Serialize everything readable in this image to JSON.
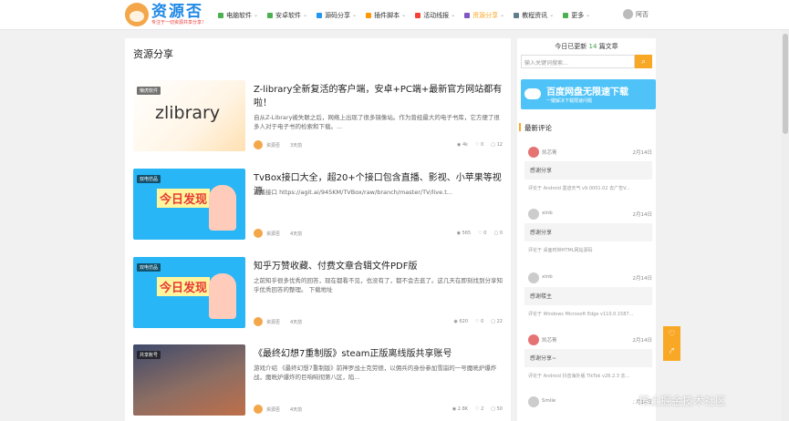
{
  "header": {
    "logo_text": "资源否",
    "logo_sub": "专注于一切资源共享分享！",
    "nav": [
      {
        "label": "电脑软件",
        "color": "#4caf50"
      },
      {
        "label": "安卓软件",
        "color": "#4caf50"
      },
      {
        "label": "源码分享",
        "color": "#2196f3"
      },
      {
        "label": "插件脚本",
        "color": "#ff9800"
      },
      {
        "label": "活动线报",
        "color": "#f44336"
      },
      {
        "label": "资源分享",
        "color": "#7e57c2"
      },
      {
        "label": "教程资讯",
        "color": "#607d8b"
      },
      {
        "label": "更多",
        "color": "#4caf50"
      }
    ],
    "user_label": "阿否"
  },
  "main": {
    "section_title": "资源分享",
    "posts": [
      {
        "badge": "懒虎软件",
        "thumb_text": "zlibrary",
        "title": "Z-library全新复活的客户端，安卓+PC端+最新官方网站都有啦！",
        "excerpt": "自从Z-Library被失联之后，网络上出现了很多镜像站。作为曾经最大的电子书库，它方便了很多人对于电子书的检索和下载。...",
        "author": "资源否",
        "time": "3天前",
        "views": "4k",
        "likes": "0",
        "comments": "12"
      },
      {
        "badge": "双电仿品",
        "thumb_text": "今日发现",
        "title": "TvBox接口大全，超20+个接口包含直播、影视、小苹果等视源",
        "excerpt": "直播接口 https://agit.ai/945KM/TVBox/raw/branch/master/TV/live.t...",
        "author": "资源否",
        "time": "4天前",
        "views": "565",
        "likes": "0",
        "comments": "0"
      },
      {
        "badge": "双电仿品",
        "thumb_text": "今日发现",
        "title": "知乎万赞收藏、付费文章合辑文件PDF版",
        "excerpt": "之前知乎很多优秀的回答，现在都看不见，也没有了，都不会去逛了。这几天在即刻找到分享知乎优秀回答的整理。 下载地址",
        "author": "资源否",
        "time": "4天前",
        "views": "620",
        "likes": "0",
        "comments": "22"
      },
      {
        "badge": "共享账号",
        "thumb_text": "",
        "title": "《最终幻想7重制版》steam正版离线版共享账号",
        "excerpt": "游戏介绍 《最终幻想7重制版》前神罗战士克劳德，以佣兵的身份参加雪崩的一号魔晄炉爆炸战，魔晄炉爆炸的巨响响彻第八区，陷...",
        "author": "资源否",
        "time": "4天前",
        "views": "2.8K",
        "likes": "2",
        "comments": "50"
      }
    ]
  },
  "sidebar": {
    "today_prefix": "今日已更新",
    "today_count": "14",
    "today_suffix": "篇文章",
    "search_placeholder": "输入关键词搜索...",
    "banner_title": "百度网盘无限速下载",
    "banner_sub": "一键解决下载限速问题",
    "comments_title": "最新评论",
    "comments": [
      {
        "name": "凯芯菁",
        "date": "2月14日",
        "body": "感谢分享",
        "target": "评论于 Android 墨迹天气 v9.0001.02 去广告V..."
      },
      {
        "name": "xinb",
        "date": "2月14日",
        "body": "感谢分享",
        "target": "评论于 桌面时钟HTML网站源码"
      },
      {
        "name": "xinb",
        "date": "2月14日",
        "body": "感谢楼主",
        "target": "评论于 Windows Microsoft Edge v110.0.1587..."
      },
      {
        "name": "凯芯菁",
        "date": "2月14日",
        "body": "感谢分享~",
        "target": "评论于 Android 抖音海外版 TikTok v28.2.3 去..."
      },
      {
        "name": "Smile",
        "date": "2月14日",
        "body": "",
        "target": ""
      }
    ]
  },
  "float": {
    "like_icon": "♡",
    "share_icon": "⤤"
  },
  "watermark": "稀土掘金技术社区"
}
